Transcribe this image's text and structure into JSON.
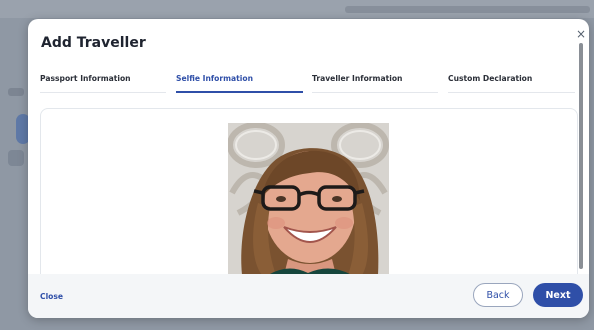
{
  "modal": {
    "title": "Add Traveller",
    "close_symbol": "×"
  },
  "tabs": [
    {
      "label": "Passport Information",
      "active": false
    },
    {
      "label": "Selfie Information",
      "active": true
    },
    {
      "label": "Traveller Information",
      "active": false
    },
    {
      "label": "Custom Declaration",
      "active": false
    }
  ],
  "footer": {
    "close_label": "Close",
    "back_label": "Back",
    "next_label": "Next"
  },
  "colors": {
    "accent": "#2f4fa8",
    "backdrop": "#8f98a4",
    "footer_bg": "#f4f6f8"
  },
  "icons": {
    "modal_close": "close-icon"
  }
}
